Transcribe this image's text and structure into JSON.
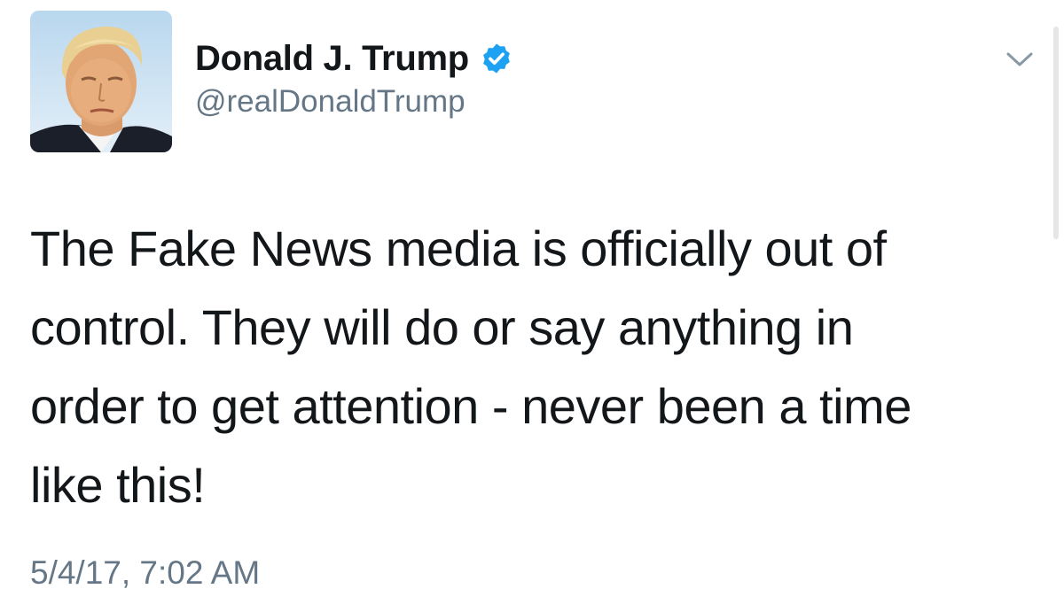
{
  "profile": {
    "display_name": "Donald J. Trump",
    "handle": "@realDonaldTrump",
    "avatar_icon": "profile-photo-icon",
    "verified_icon": "verified-badge-icon",
    "verified_color": "#1da1f2"
  },
  "menu": {
    "icon": "chevron-down-icon",
    "color": "#8899a6"
  },
  "tweet": {
    "lines": [
      "The Fake News media is officially out of",
      "control. They will do or say anything in",
      "order to get attention - never been a time",
      "like this!"
    ],
    "timestamp": "5/4/17, 7:02 AM"
  },
  "colors": {
    "text": "#14171a",
    "secondary_text": "#657786",
    "background": "#ffffff"
  }
}
